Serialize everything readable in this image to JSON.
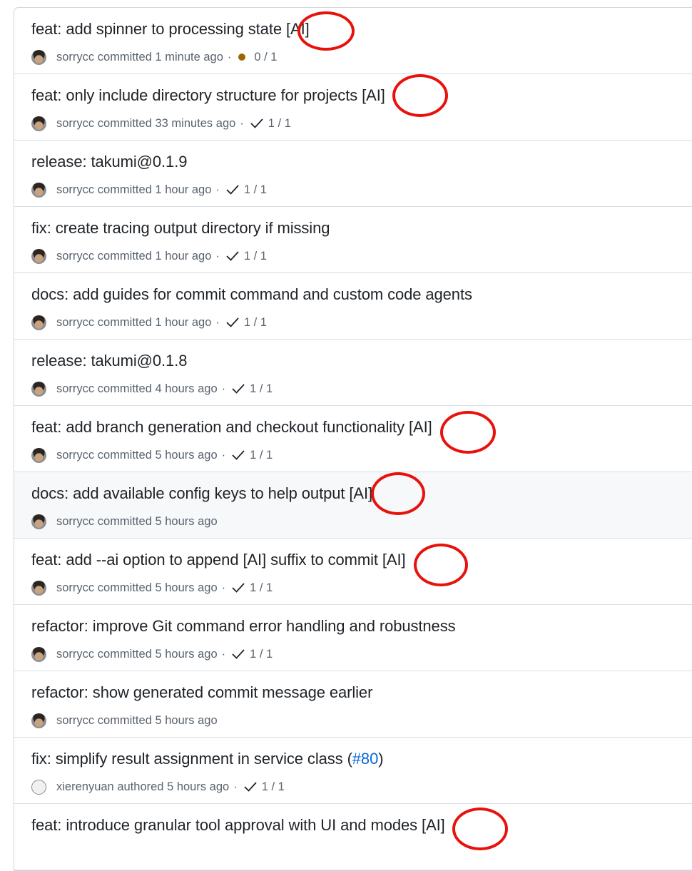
{
  "commits": [
    {
      "title": "feat: add spinner to processing state [AI]",
      "author": "sorrycc",
      "verb": "committed",
      "time": "1 minute ago",
      "status": "pending",
      "checks": "0 / 1"
    },
    {
      "title": "feat: only include directory structure for projects [AI]",
      "author": "sorrycc",
      "verb": "committed",
      "time": "33 minutes ago",
      "status": "success",
      "checks": "1 / 1"
    },
    {
      "title": "release: takumi@0.1.9",
      "author": "sorrycc",
      "verb": "committed",
      "time": "1 hour ago",
      "status": "success",
      "checks": "1 / 1"
    },
    {
      "title": "fix: create tracing output directory if missing",
      "author": "sorrycc",
      "verb": "committed",
      "time": "1 hour ago",
      "status": "success",
      "checks": "1 / 1"
    },
    {
      "title": "docs: add guides for commit command and custom code agents",
      "author": "sorrycc",
      "verb": "committed",
      "time": "1 hour ago",
      "status": "success",
      "checks": "1 / 1"
    },
    {
      "title": "release: takumi@0.1.8",
      "author": "sorrycc",
      "verb": "committed",
      "time": "4 hours ago",
      "status": "success",
      "checks": "1 / 1"
    },
    {
      "title": "feat: add branch generation and checkout functionality [AI]",
      "author": "sorrycc",
      "verb": "committed",
      "time": "5 hours ago",
      "status": "success",
      "checks": "1 / 1"
    },
    {
      "title": "docs: add available config keys to help output [AI]",
      "author": "sorrycc",
      "verb": "committed",
      "time": "5 hours ago",
      "status": "none",
      "checks": ""
    },
    {
      "title": "feat: add --ai option to append [AI] suffix to commit [AI]",
      "author": "sorrycc",
      "verb": "committed",
      "time": "5 hours ago",
      "status": "success",
      "checks": "1 / 1"
    },
    {
      "title": "refactor: improve Git command error handling and robustness",
      "author": "sorrycc",
      "verb": "committed",
      "time": "5 hours ago",
      "status": "success",
      "checks": "1 / 1"
    },
    {
      "title": "refactor: show generated commit message earlier",
      "author": "sorrycc",
      "verb": "committed",
      "time": "5 hours ago",
      "status": "none",
      "checks": ""
    },
    {
      "title": "fix: simplify result assignment in service class (",
      "pr": "#80",
      "title_suffix": ")",
      "author": "xierenyuan",
      "verb": "authored",
      "time": "5 hours ago",
      "status": "success",
      "checks": "1 / 1"
    },
    {
      "title": "feat: introduce granular tool approval with UI and modes [AI]",
      "author": "",
      "verb": "",
      "time": "",
      "status": "none",
      "checks": ""
    }
  ],
  "meta_separator": "·",
  "colors": {
    "annotation": "#e8120c",
    "pending": "#9a6700",
    "link": "#0969da"
  }
}
